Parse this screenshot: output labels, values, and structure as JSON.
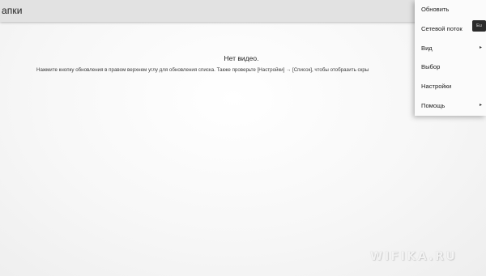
{
  "header": {
    "title": "апки"
  },
  "main": {
    "empty_title": "Нет видео.",
    "empty_hint": "Нажмите кнопку обновления в правом верхнем углу для обновления списка. Также проверьте [Настройки] → [Список], чтобы отобразить скры"
  },
  "menu": {
    "items": [
      {
        "label": "Обновить"
      },
      {
        "label": "Сетевой поток"
      },
      {
        "label": "Вид",
        "submenu": "▸"
      },
      {
        "label": "Выбор"
      },
      {
        "label": "Настройки"
      },
      {
        "label": "Помощь",
        "submenu": "▸"
      }
    ]
  },
  "tooltip_chip": "Eu",
  "watermark": "WIFIKA.RU",
  "colors": {
    "titlebar": "#e2e2e2",
    "menu_bg": "#fbfbfb",
    "content_bg": "#fafafa"
  }
}
